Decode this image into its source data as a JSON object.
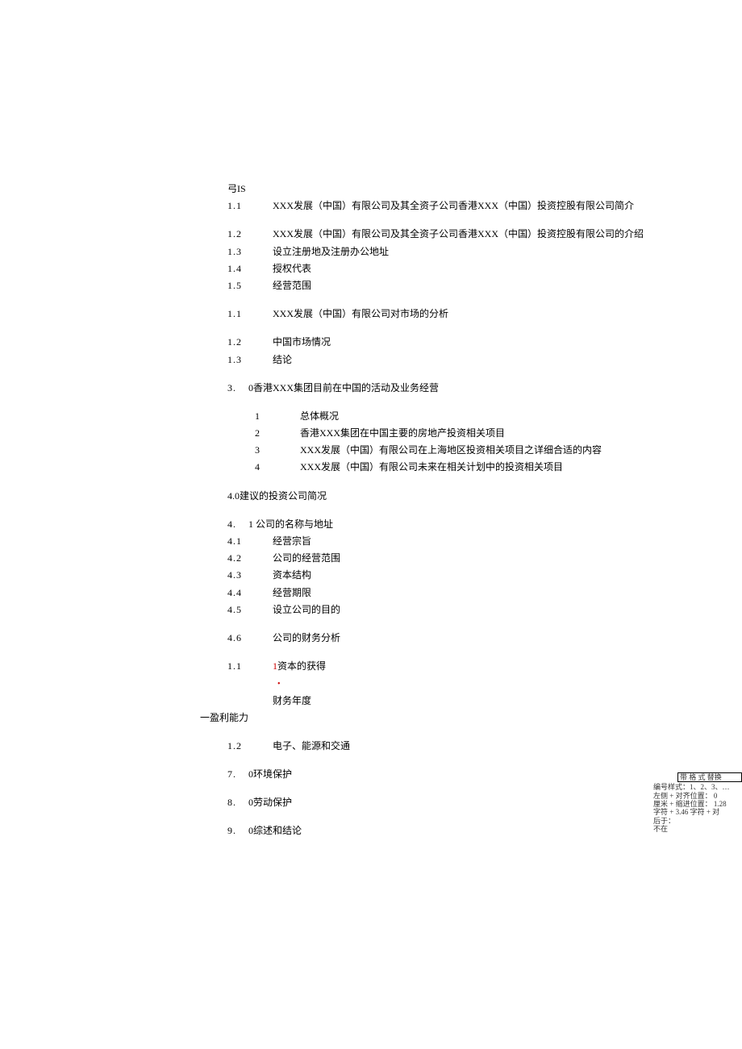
{
  "header": "弓IS",
  "lines": [
    {
      "n": "1.1",
      "t": "XXX发展（中国）有限公司及其全资子公司香港XXX（中国）投资控股有限公司简介",
      "indent": 0
    },
    {
      "spacer": true
    },
    {
      "n": "1.2",
      "t": "XXX发展（中国）有限公司及其全资子公司香港XXX（中国）投资控股有限公司的介绍",
      "indent": 0
    },
    {
      "n": "1.3",
      "t": "设立注册地及注册办公地址",
      "indent": 0
    },
    {
      "n": "1.4",
      "t": "授权代表",
      "indent": 0
    },
    {
      "n": "1.5",
      "t": "经营范围",
      "indent": 0
    },
    {
      "spacer": true
    },
    {
      "n": "1.1",
      "t": "XXX发展（中国）有限公司对市场的分析",
      "indent": 0
    },
    {
      "spacer": true
    },
    {
      "n": "1.2",
      "t": "中国市场情况",
      "indent": 0
    },
    {
      "n": "1.3",
      "t": "结论",
      "indent": 0
    },
    {
      "spacer": true
    },
    {
      "n": "3.",
      "t": "0香港XXX集团目前在中国的活动及业务经营",
      "indent": 0,
      "tight": true
    },
    {
      "spacer": true
    },
    {
      "n": "1",
      "t": "总体概况",
      "indent": 1
    },
    {
      "n": "2",
      "t": "香港XXX集团在中国主要的房地产投资相关项目",
      "indent": 1
    },
    {
      "n": "3",
      "t": "XXX发展（中国）有限公司在上海地区投资相关项目之详细合适的内容",
      "indent": 1
    },
    {
      "n": "4",
      "t": "XXX发展（中国）有限公司未来在相关计划中的投资相关项目",
      "indent": 1
    },
    {
      "spacer": true
    },
    {
      "n": "",
      "t": "4.0建议的投资公司简况",
      "indent": 0,
      "raw": true
    },
    {
      "spacer": true
    },
    {
      "n": "4.",
      "t": "1  公司的名称与地址",
      "indent": 0,
      "tight": true
    },
    {
      "n": "4.1",
      "t": "经营宗旨",
      "indent": 0
    },
    {
      "n": "4.2",
      "t": "公司的经营范围",
      "indent": 0
    },
    {
      "n": "4.3",
      "t": "资本结构",
      "indent": 0
    },
    {
      "n": "4.4",
      "t": "经营期限",
      "indent": 0
    },
    {
      "n": "4.5",
      "t": "设立公司的目的",
      "indent": 0
    },
    {
      "spacer": true
    },
    {
      "n": "4.6",
      "t": "公司的财务分析",
      "indent": 0
    },
    {
      "spacer": true
    },
    {
      "n": "1.1",
      "t": "资本的获得",
      "indent": 0,
      "redprefix": "1"
    },
    {
      "bullet": true
    },
    {
      "n": "",
      "t": "财务年度",
      "indent": 0,
      "pad": true
    },
    {
      "n": "",
      "t": "一盈利能力",
      "indent": 0,
      "raw": true,
      "noleft": true
    },
    {
      "spacer": true
    },
    {
      "n": "1.2",
      "t": "电子、能源和交通",
      "indent": 0
    },
    {
      "spacer": true
    },
    {
      "n": "7.",
      "t": "0环境保护",
      "indent": 0,
      "tight": true
    },
    {
      "spacer": true
    },
    {
      "n": "8.",
      "t": "0劳动保护",
      "indent": 0,
      "tight": true
    },
    {
      "spacer": true
    },
    {
      "n": "9.",
      "t": "0综述和结论",
      "indent": 0,
      "tight": true
    }
  ],
  "annotation": {
    "header": "带 格 式 替换",
    "body": "编号样式：1、2、3、…\n左侧 + 对齐位置：   0\n厘米 + 缩进位置：  1.28\n字符 +  3.46 字符 + 对\n                                后于：\n                                    不在"
  }
}
